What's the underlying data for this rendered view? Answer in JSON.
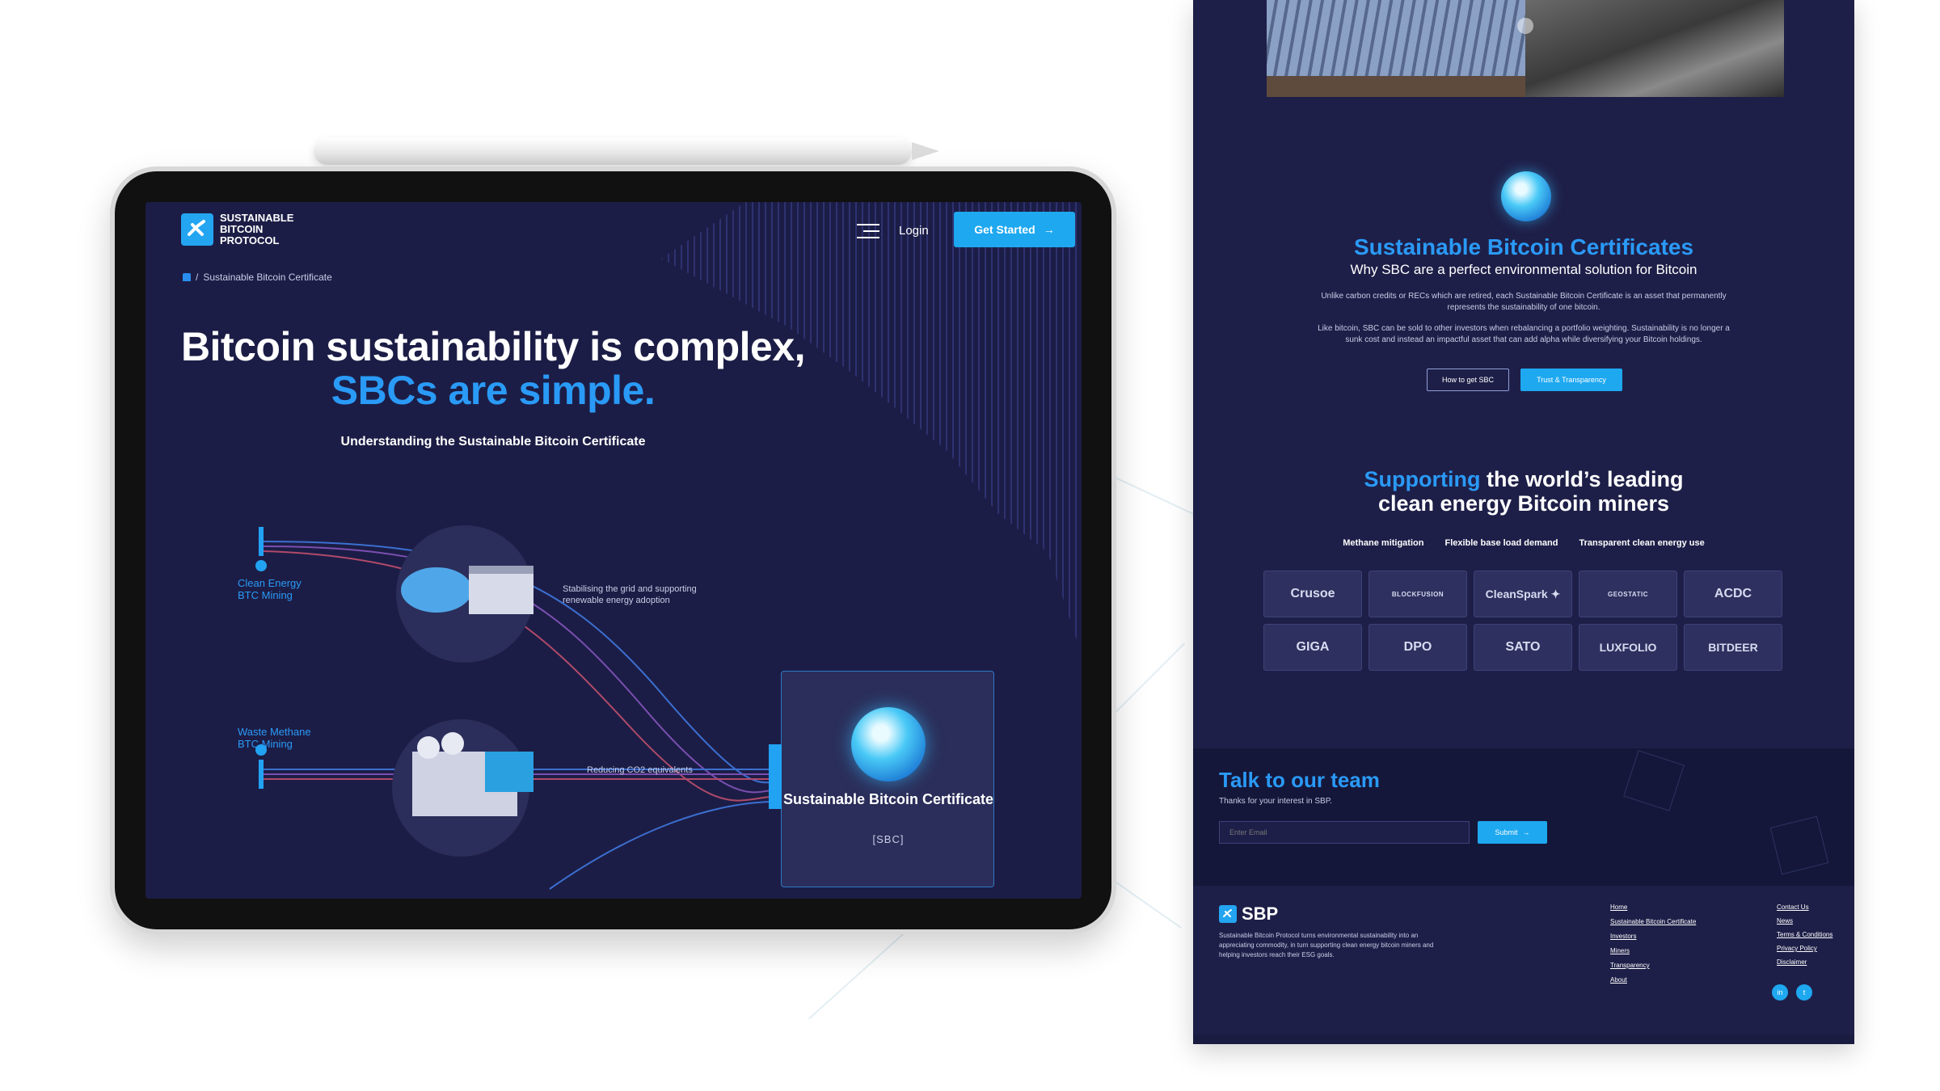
{
  "tablet": {
    "brand_logo_text": "SUSTAINABLE BITCOIN PROTOCOL",
    "nav": {
      "login": "Login",
      "get_started": "Get Started"
    },
    "breadcrumb": {
      "separator": "/",
      "current": "Sustainable Bitcoin Certificate"
    },
    "hero": {
      "title_line1": "Bitcoin sustainability is complex,",
      "title_line2": "SBCs are simple.",
      "subtitle": "Understanding the Sustainable Bitcoin Certificate"
    },
    "flow": {
      "clean": {
        "label": "Clean Energy BTC Mining",
        "desc": "Stabilising the grid and supporting renewable energy adoption"
      },
      "methane": {
        "label": "Waste Methane BTC Mining",
        "desc": "Reducing CO2 equivalents"
      },
      "sbc": {
        "title": "Sustainable Bitcoin Certificate",
        "tag": "[SBC]"
      }
    }
  },
  "page": {
    "sbc_section": {
      "title": "Sustainable Bitcoin Certificates",
      "subtitle": "Why SBC are a perfect environmental solution for Bitcoin",
      "para1": "Unlike carbon credits or RECs which are retired, each Sustainable Bitcoin Certificate is an asset that permanently represents the sustainability of one bitcoin.",
      "para2": "Like bitcoin, SBC can be sold to other investors when rebalancing a portfolio weighting. Sustainability is no longer a sunk cost and instead an impactful asset that can add alpha while diversifying your Bitcoin holdings.",
      "btn_how": "How to get SBC",
      "btn_trust": "Trust & Transparency"
    },
    "miners_section": {
      "title_highlight": "Supporting",
      "title_rest1": "the world’s leading",
      "title_line2": "clean energy Bitcoin miners",
      "tags": [
        "Methane mitigation",
        "Flexible base load demand",
        "Transparent clean energy use"
      ],
      "logos": [
        "Crusoe",
        "BLOCKFUSION",
        "CleanSpark ✦",
        "GEOSTATIC",
        "ACDC",
        "GIGA",
        "DPO",
        "SATO",
        "LUXFOLIO",
        "BITDEER"
      ]
    },
    "talk": {
      "title": "Talk to our team",
      "subtitle": "Thanks for your interest in SBP.",
      "email_placeholder": "Enter Email",
      "submit": "Submit"
    },
    "footer": {
      "brand": "SBP",
      "desc": "Sustainable Bitcoin Protocol turns environmental sustainability into an appreciating commodity, in turn supporting clean energy bitcoin miners and helping investors reach their ESG goals.",
      "col1": [
        "Home",
        "Sustainable Bitcoin Certificate",
        "Investors",
        "Miners",
        "Transparency",
        "About"
      ],
      "col2": [
        "Contact Us",
        "News",
        "Terms & Conditions",
        "Privacy Policy",
        "Disclaimer"
      ],
      "social": [
        "in",
        "t"
      ]
    }
  },
  "colors": {
    "navy": "#1e1f48",
    "accent": "#2a9af7",
    "button": "#1ea8f0"
  }
}
